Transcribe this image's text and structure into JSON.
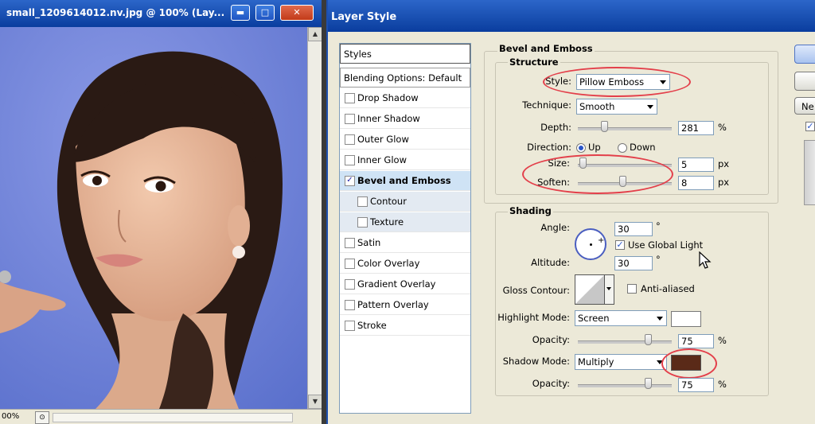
{
  "image_window": {
    "title": "small_1209614012.nv.jpg @ 100% (Lay...",
    "zoom": "00%",
    "buttons": {
      "minimize": "▬",
      "maximize": "□",
      "close": "✕"
    }
  },
  "dialog": {
    "title": "Layer Style",
    "styles_list": {
      "header": "Styles",
      "blending": "Blending Options: Default",
      "items": [
        {
          "label": "Drop Shadow",
          "checked": false
        },
        {
          "label": "Inner Shadow",
          "checked": false
        },
        {
          "label": "Outer Glow",
          "checked": false
        },
        {
          "label": "Inner Glow",
          "checked": false
        },
        {
          "label": "Bevel and Emboss",
          "checked": true
        },
        {
          "label": "Contour",
          "checked": false
        },
        {
          "label": "Texture",
          "checked": false
        },
        {
          "label": "Satin",
          "checked": false
        },
        {
          "label": "Color Overlay",
          "checked": false
        },
        {
          "label": "Gradient Overlay",
          "checked": false
        },
        {
          "label": "Pattern Overlay",
          "checked": false
        },
        {
          "label": "Stroke",
          "checked": false
        }
      ]
    },
    "bevel": {
      "section_title": "Bevel and Emboss",
      "structure_title": "Structure",
      "style_label": "Style:",
      "style_value": "Pillow Emboss",
      "technique_label": "Technique:",
      "technique_value": "Smooth",
      "depth_label": "Depth:",
      "depth_value": "281",
      "depth_unit": "%",
      "direction_label": "Direction:",
      "direction_up": "Up",
      "direction_down": "Down",
      "size_label": "Size:",
      "size_value": "5",
      "size_unit": "px",
      "soften_label": "Soften:",
      "soften_value": "8",
      "soften_unit": "px"
    },
    "shading": {
      "title": "Shading",
      "angle_label": "Angle:",
      "angle_value": "30",
      "angle_unit": "°",
      "use_global_light": "Use Global Light",
      "altitude_label": "Altitude:",
      "altitude_value": "30",
      "altitude_unit": "°",
      "gloss_label": "Gloss Contour:",
      "anti_aliased": "Anti-aliased",
      "highlight_label": "Highlight Mode:",
      "highlight_value": "Screen",
      "highlight_color": "#ffffff",
      "opacity_label": "Opacity:",
      "highlight_opacity": "75",
      "shadow_label": "Shadow Mode:",
      "shadow_value": "Multiply",
      "shadow_color": "#5a2a18",
      "shadow_opacity": "75",
      "percent": "%"
    },
    "right_buttons": {
      "new": "Ne"
    }
  }
}
